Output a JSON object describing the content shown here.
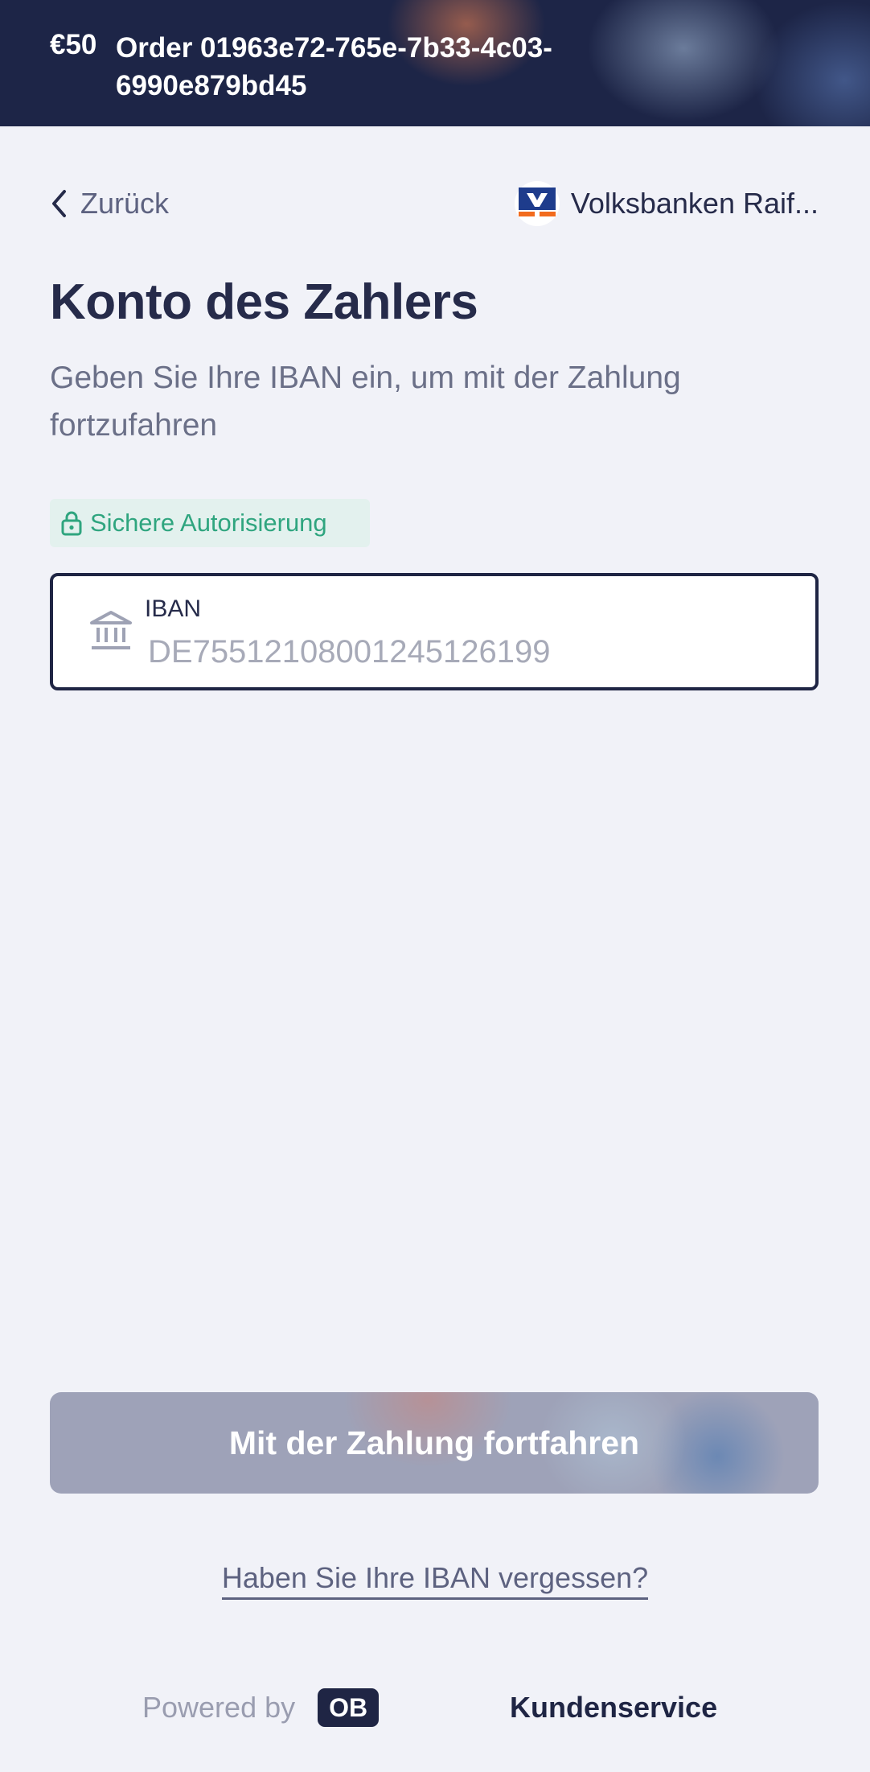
{
  "header": {
    "amount": "€50",
    "order": "Order 01963e72-765e-7b33-4c03-6990e879bd45"
  },
  "nav": {
    "back_label": "Zurück",
    "bank_name": "Volksbanken Raif..."
  },
  "main": {
    "title": "Konto des Zahlers",
    "subtitle": "Geben Sie Ihre IBAN ein, um mit der Zahlung fortzufahren",
    "secure_badge": "Sichere Autorisierung",
    "iban_field": {
      "label": "IBAN",
      "placeholder": "DE75512108001245126199",
      "value": ""
    },
    "continue_label": "Mit der Zahlung fortfahren",
    "forgot_link": "Haben Sie Ihre IBAN vergessen?"
  },
  "footer": {
    "powered_by": "Powered by",
    "logo_text": "OB",
    "support_label": "Kundenservice"
  },
  "icons": {
    "back": "chevron-left-icon",
    "lock": "lock-icon",
    "bank": "bank-icon",
    "bank_logo": "volksbank-logo"
  },
  "colors": {
    "header_bg": "#1d2547",
    "page_bg": "#f1f2f8",
    "text_primary": "#262b4a",
    "secure_green": "#2fa57f",
    "secure_bg": "#e3f1ee",
    "button_disabled": "#9ea2b8",
    "bank_logo_blue": "#1e3c8c",
    "bank_logo_orange": "#f26b1d"
  }
}
